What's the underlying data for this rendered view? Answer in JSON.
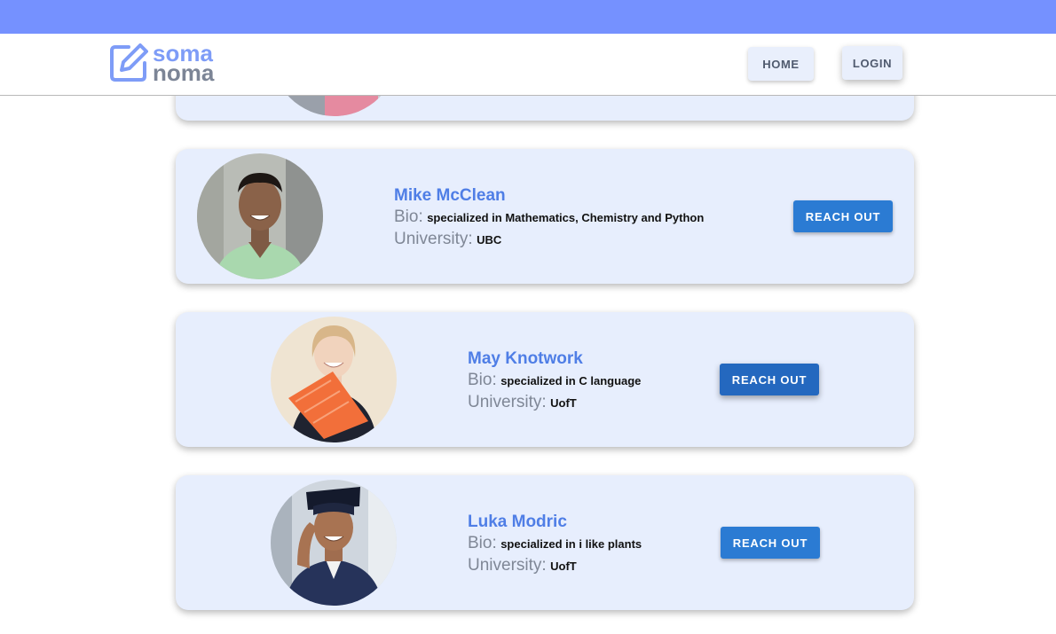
{
  "brand": {
    "line1": "soma",
    "line2": "noma"
  },
  "nav": {
    "home_label": "HOME",
    "login_label": "LOGIN"
  },
  "labels": {
    "bio": "Bio:",
    "university": "University:"
  },
  "tutors": [
    {
      "name": "Mike McClean",
      "bio": "specialized in Mathematics, Chemistry and Python",
      "university": "UBC",
      "action": "REACH OUT"
    },
    {
      "name": "May Knotwork",
      "bio": "specialized in C language",
      "university": "UofT",
      "action": "REACH OUT"
    },
    {
      "name": "Luka Modric",
      "bio": "specialized in i like plants",
      "university": "UofT",
      "action": "REACH OUT"
    }
  ],
  "colors": {
    "top_strip": "#7591ff",
    "card_bg": "#e7eefd",
    "name_blue": "#4f7ee6",
    "button_blue": "#2b7bd3"
  }
}
